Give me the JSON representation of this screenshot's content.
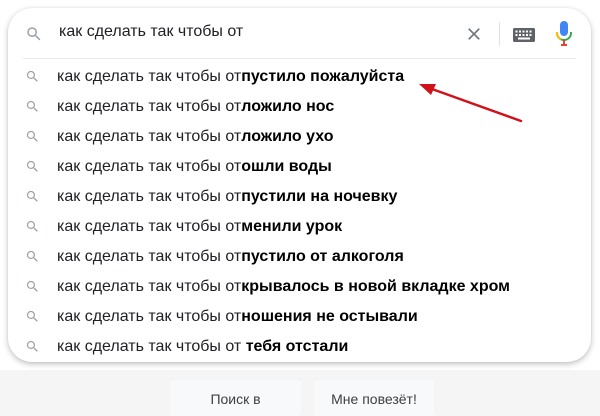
{
  "search": {
    "query": "как сделать так чтобы от"
  },
  "suggestions": [
    {
      "prefix": "как сделать так чтобы от",
      "completion": "пустило пожалуйста"
    },
    {
      "prefix": "как сделать так чтобы от",
      "completion": "ложило нос"
    },
    {
      "prefix": "как сделать так чтобы от",
      "completion": "ложило ухо"
    },
    {
      "prefix": "как сделать так чтобы от",
      "completion": "ошли воды"
    },
    {
      "prefix": "как сделать так чтобы от",
      "completion": "пустили на ночевку"
    },
    {
      "prefix": "как сделать так чтобы от",
      "completion": "менили урок"
    },
    {
      "prefix": "как сделать так чтобы от",
      "completion": "пустило от алкоголя"
    },
    {
      "prefix": "как сделать так чтобы от",
      "completion": "крывалось в новой вкладке хром"
    },
    {
      "prefix": "как сделать так чтобы от",
      "completion": "ношения не остывали"
    },
    {
      "prefix": "как сделать так чтобы от ",
      "completion": "тебя отстали"
    }
  ],
  "buttons": {
    "search_label": "Поиск в Google",
    "lucky_label": "Мне повезёт!"
  },
  "icons": {
    "search": "search-icon",
    "clear": "close-icon",
    "keyboard": "keyboard-icon",
    "mic": "microphone-icon"
  },
  "colors": {
    "annotation_arrow": "#d0121b",
    "mic_blue": "#4285f4",
    "mic_red": "#ea4335",
    "mic_yellow": "#fbbc04",
    "mic_green": "#34a853"
  }
}
